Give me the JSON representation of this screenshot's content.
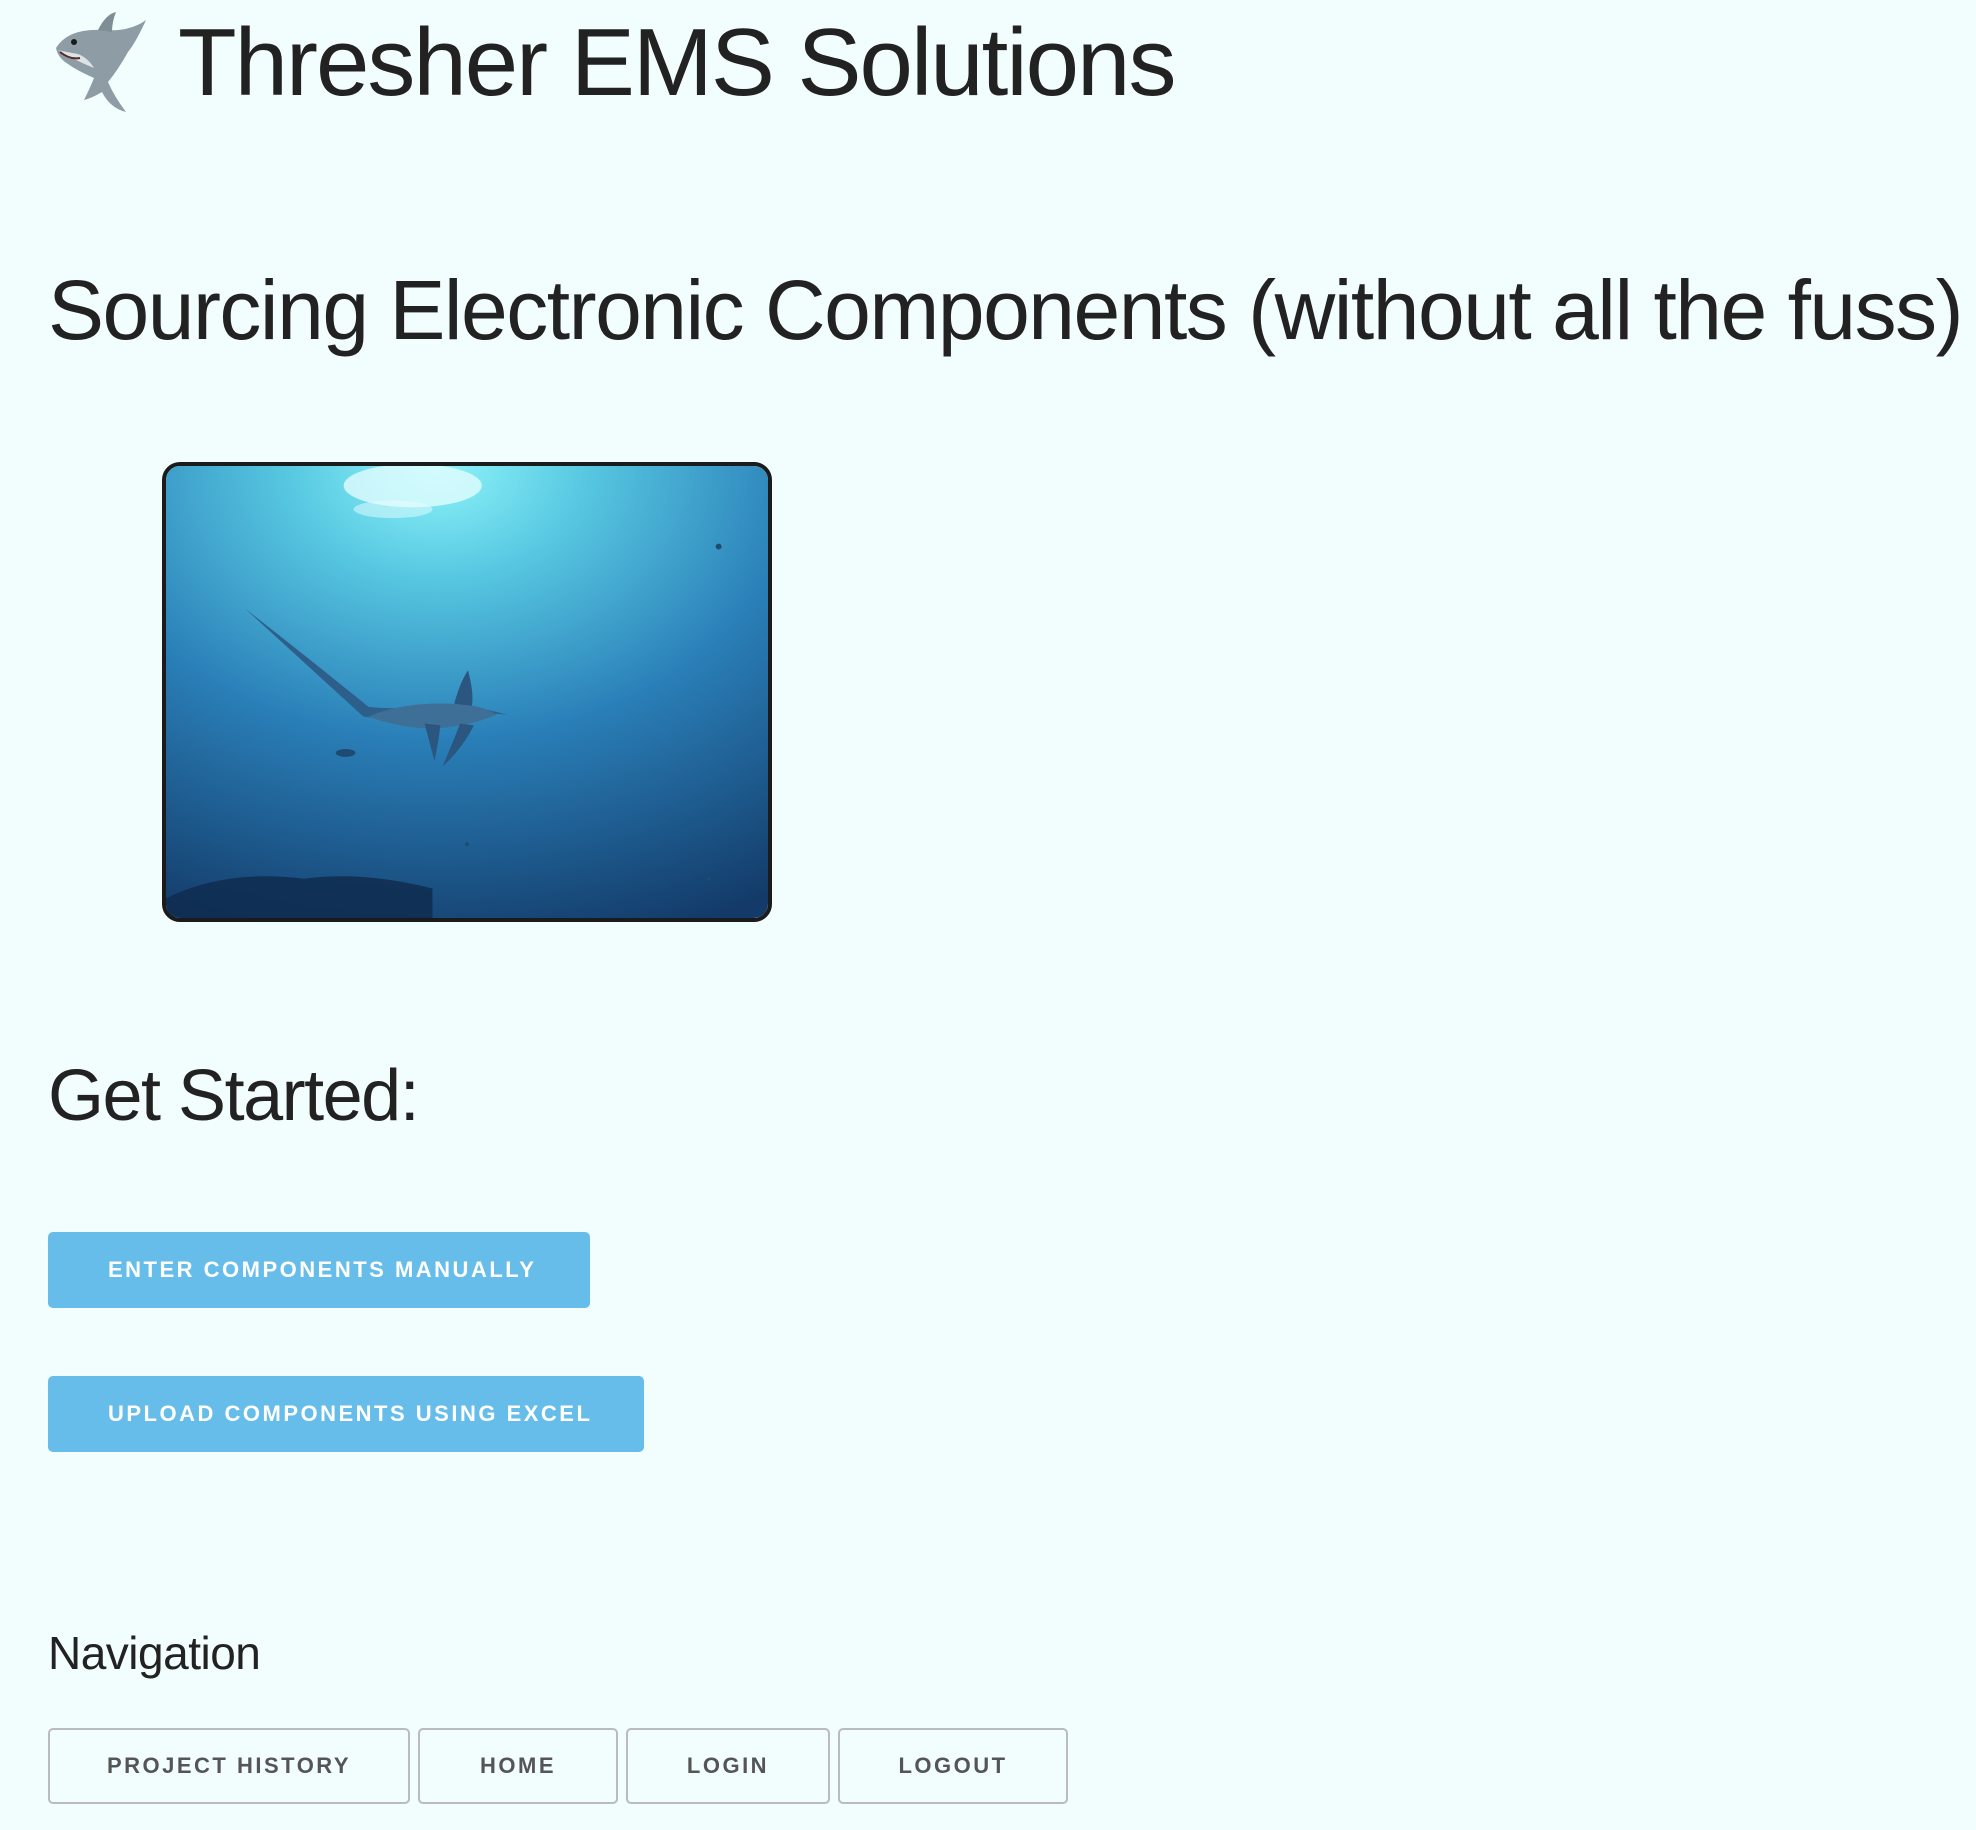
{
  "header": {
    "logo_icon": "shark-icon",
    "title": "Thresher EMS Solutions"
  },
  "hero": {
    "tagline": "Sourcing Electronic Components (without all the fuss)",
    "image_subject": "thresher-shark-photo"
  },
  "get_started": {
    "heading": "Get Started:",
    "manual_label": "ENTER COMPONENTS MANUALLY",
    "excel_label": "UPLOAD COMPONENTS USING EXCEL"
  },
  "navigation": {
    "heading": "Navigation",
    "items": [
      {
        "label": "PROJECT HISTORY"
      },
      {
        "label": "HOME"
      },
      {
        "label": "LOGIN"
      },
      {
        "label": "LOGOUT"
      }
    ]
  },
  "colors": {
    "page_background": "#f2fefe",
    "primary_button": "#66bdea",
    "text": "#222222",
    "nav_border": "#bbbbbb"
  }
}
